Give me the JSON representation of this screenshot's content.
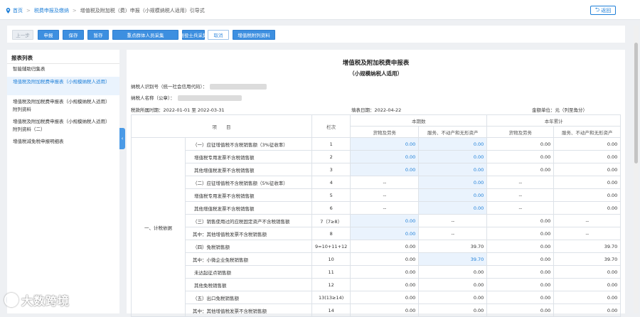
{
  "breadcrumb": {
    "home": "首页",
    "level1": "税费申报及缴纳",
    "level2": "增值税及附加税（费）申报（小规模纳税人适用）引导式"
  },
  "back_label": "返回",
  "toolbar": {
    "prev": "上一步",
    "declare": "申报",
    "save": "保存",
    "draft": "暂存",
    "key_groups": "重点群体人员采集",
    "veterans": "退役士兵采集",
    "cancel": "取消",
    "attach": "增值税附列资料"
  },
  "sidebar": {
    "title": "报表列表",
    "items": [
      "智能辅助归集表",
      "增值税及附加税费申报表（小规模纳税人适用）",
      "增值税及附加税费申报表（小规模纳税人适用）附列资料",
      "增值税及附加税费申报表（小规模纳税人适用）附列资料（二）",
      "增值税减免税申报明细表"
    ]
  },
  "form": {
    "title": "增值税及附加税费申报表",
    "subtitle": "（小规模纳税人适用）",
    "taxpayer_id_label": "纳税人识别号（统一社会信用代码）：",
    "taxpayer_name_label": "纳税人名称（公章）：",
    "period_label": "税款所属时期：2022-01-01 至 2022-03-31",
    "fill_date": "填表日期：2022-04-22",
    "unit": "金额单位：元（列至角分）"
  },
  "table": {
    "h_item": "项　　目",
    "h_col": "栏次",
    "h_current": "本期数",
    "h_ytd": "本年累计",
    "h_goods": "货物及劳务",
    "h_services": "服务、不动产和无形资产",
    "section": "一、计税依据",
    "rows": [
      {
        "label": "（一）应征增值税不含税销售额（3%征收率）",
        "col": "1",
        "v": [
          "0.00",
          "0.00",
          "0.00",
          "0.00"
        ]
      },
      {
        "label": "增值税专用发票不含税销售额",
        "col": "2",
        "v": [
          "0.00",
          "0.00",
          "0.00",
          "0.00"
        ]
      },
      {
        "label": "其他增值税发票不含税销售额",
        "col": "3",
        "v": [
          "0.00",
          "0.00",
          "0.00",
          "0.00"
        ]
      },
      {
        "label": "（二）应征增值税不含税销售额（5%征收率）",
        "col": "4",
        "v": [
          "--",
          "0.00",
          "--",
          "0.00"
        ]
      },
      {
        "label": "增值税专用发票不含税销售额",
        "col": "5",
        "v": [
          "--",
          "0.00",
          "--",
          "0.00"
        ]
      },
      {
        "label": "其他增值税发票不含税销售额",
        "col": "6",
        "v": [
          "--",
          "0.00",
          "--",
          "0.00"
        ]
      },
      {
        "label": "（三）销售使用过的应税固定资产不含税销售额",
        "col": "7（7≥8）",
        "v": [
          "0.00",
          "--",
          "0.00",
          "--"
        ]
      },
      {
        "label": "其中：其他增值税发票不含税销售额",
        "col": "8",
        "v": [
          "0.00",
          "--",
          "0.00",
          "--"
        ]
      },
      {
        "label": "（四）免税销售额",
        "col": "9=10+11+12",
        "v": [
          "0.00",
          "39.70",
          "0.00",
          "39.70"
        ]
      },
      {
        "label": "其中：小微企业免税销售额",
        "col": "10",
        "v": [
          "0.00",
          "39.70",
          "0.00",
          "39.70"
        ]
      },
      {
        "label": "未达起征点销售额",
        "col": "11",
        "v": [
          "0.00",
          "0.00",
          "0.00",
          "0.00"
        ]
      },
      {
        "label": "其他免税销售额",
        "col": "12",
        "v": [
          "0.00",
          "0.00",
          "0.00",
          "0.00"
        ]
      },
      {
        "label": "（五）出口免税销售额",
        "col": "13(13≥14)",
        "v": [
          "0.00",
          "0.00",
          "0.00",
          "0.00"
        ]
      },
      {
        "label": "其中：其他增值税发票不含税销售额",
        "col": "14",
        "v": [
          "0.00",
          "0.00",
          "0.00",
          "0.00"
        ]
      }
    ]
  },
  "watermark": "大数跨境"
}
